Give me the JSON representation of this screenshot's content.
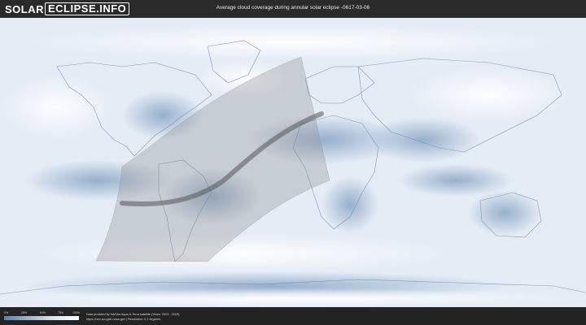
{
  "header": {
    "logo_solar": "SOLAR",
    "logo_eclipse": "ECLIPSE.INFO",
    "title": "Average cloud coverage during annular solar eclipse -0617-03-06"
  },
  "legend": {
    "ticks": [
      "0%",
      "25%",
      "50%",
      "75%",
      "100%"
    ],
    "colors": [
      "#5e7fa6",
      "#9fb4cc",
      "#dbe5f0",
      "#ffffff"
    ]
  },
  "credits": {
    "line1": "Data provided by NASAs Aqua & Terra satellite (Years: 2003 - 2019)",
    "line2": "https://neo.sci.gsfc.nasa.gov | Resolution: 0.1 degrees"
  },
  "map": {
    "ocean_color": "#e9f0f8",
    "cloud_light": "#ffffff",
    "cloud_dark": "#8aa3c2",
    "eclipse_band_color": "#8c8c8c",
    "center_line_color": "#555555"
  }
}
